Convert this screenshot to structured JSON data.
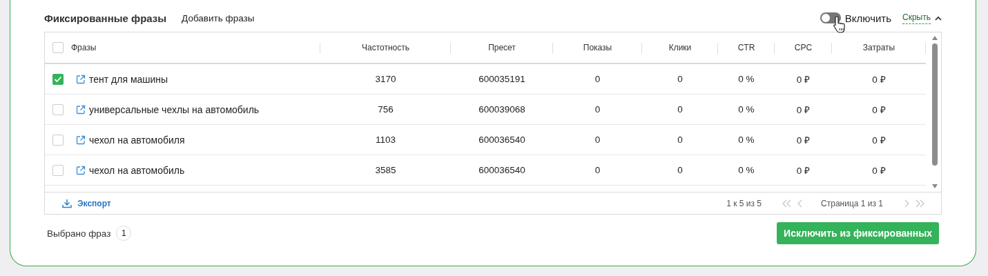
{
  "panel": {
    "title": "Фиксированные фразы",
    "add_link": "Добавить фразы",
    "toggle": {
      "label": "Включить",
      "on": false
    },
    "collapse_link": "Скрыть",
    "expanded": true
  },
  "table": {
    "select_all": {
      "checked": false
    },
    "columns": [
      "Фразы",
      "Частотность",
      "Пресет",
      "Показы",
      "Клики",
      "CTR",
      "CPC",
      "Затраты"
    ],
    "rows": [
      {
        "checked": true,
        "cells": [
          "тент для машины",
          "3170",
          "600035191",
          "0",
          "0",
          "0 %",
          "0 ₽",
          "0 ₽"
        ]
      },
      {
        "checked": false,
        "cells": [
          "универсальные чехлы на автомобиль",
          "756",
          "600039068",
          "0",
          "0",
          "0 %",
          "0 ₽",
          "0 ₽"
        ]
      },
      {
        "checked": false,
        "cells": [
          "чехол на автомобиля",
          "1103",
          "600036540",
          "0",
          "0",
          "0 %",
          "0 ₽",
          "0 ₽"
        ]
      },
      {
        "checked": false,
        "cells": [
          "чехол на автомобиль",
          "3585",
          "600036540",
          "0",
          "0",
          "0 %",
          "0 ₽",
          "0 ₽"
        ]
      }
    ],
    "footer": {
      "export": "Экспорт",
      "range": "1 к 5 из 5",
      "page": "Страница 1 из 1"
    }
  },
  "selection": {
    "label": "Выбрано фраз",
    "count": "1"
  },
  "action_button": "Исключить из фиксированных"
}
